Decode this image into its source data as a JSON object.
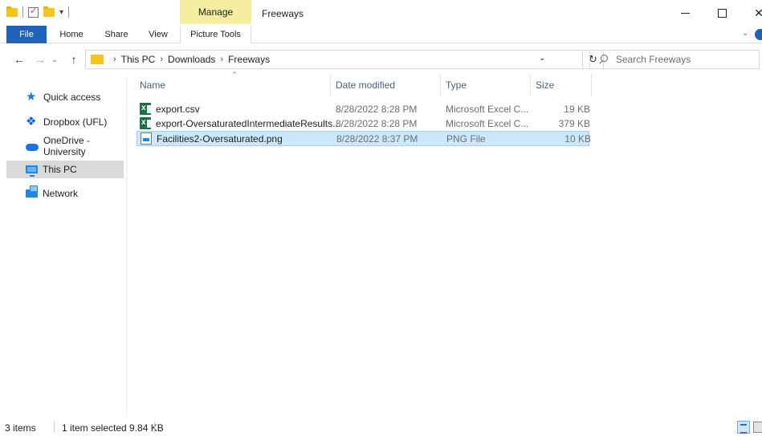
{
  "window": {
    "title": "Freeways",
    "contextual_tab_group": "Manage"
  },
  "ribbon": {
    "tabs": [
      "File",
      "Home",
      "Share",
      "View",
      "Picture Tools"
    ]
  },
  "address": {
    "crumbs": [
      "This PC",
      "Downloads",
      "Freeways"
    ],
    "search_placeholder": "Search Freeways"
  },
  "sidebar": {
    "items": [
      {
        "label": "Quick access",
        "icon": "star-icon"
      },
      {
        "label": "Dropbox (UFL)",
        "icon": "dropbox-icon"
      },
      {
        "label": "OneDrive - University",
        "icon": "onedrive-icon"
      },
      {
        "label": "This PC",
        "icon": "this-pc-icon",
        "selected": true
      },
      {
        "label": "Network",
        "icon": "network-icon"
      }
    ]
  },
  "columns": {
    "name": "Name",
    "date": "Date modified",
    "type": "Type",
    "size": "Size"
  },
  "files": [
    {
      "name": "export.csv",
      "date": "8/28/2022 8:28 PM",
      "type": "Microsoft Excel C...",
      "size": "19 KB",
      "icon": "excel-icon"
    },
    {
      "name": "export-OversaturatedIntermediateResults...",
      "date": "8/28/2022 8:28 PM",
      "type": "Microsoft Excel C...",
      "size": "379 KB",
      "icon": "excel-icon"
    },
    {
      "name": "Facilities2-Oversaturated.png",
      "date": "8/28/2022 8:37 PM",
      "type": "PNG File",
      "size": "10 KB",
      "icon": "image-file-icon",
      "selected": true
    }
  ],
  "status": {
    "count": "3 items",
    "selection": "1 item selected  9.84 KB"
  },
  "colors": {
    "file_tab": "#1f63b8",
    "manage_tab": "#f6ee9f",
    "selection": "#cce8ff",
    "sidebar_selected": "#d9d9d9"
  }
}
